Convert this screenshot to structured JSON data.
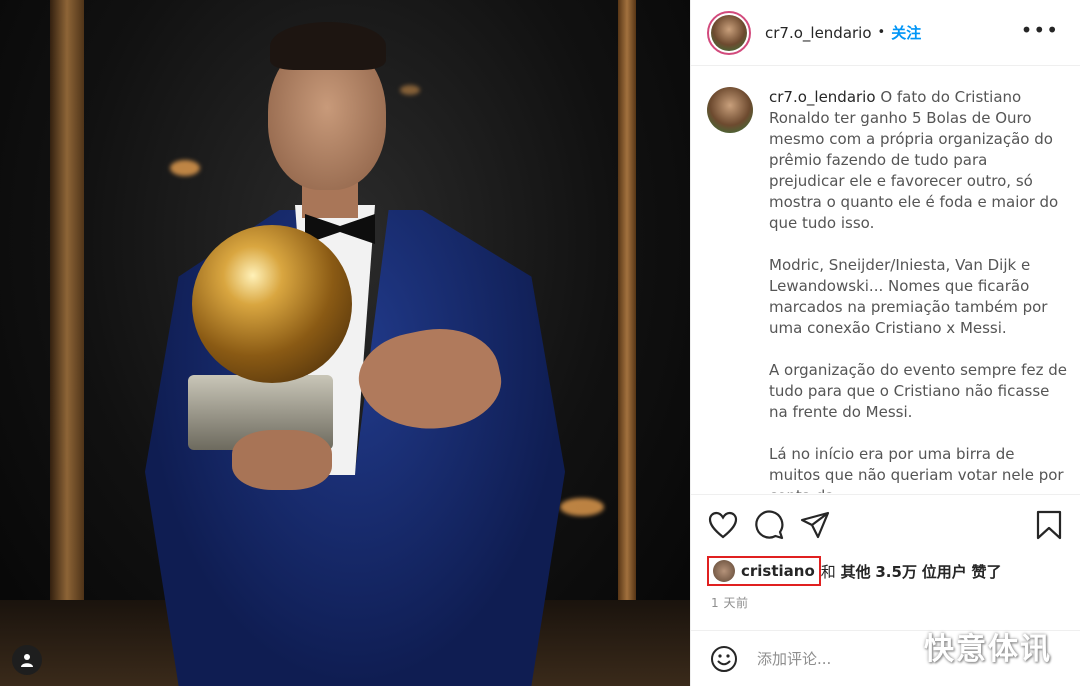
{
  "post": {
    "username": "cr7.o_lendario",
    "separator": "•",
    "follow_label": "关注",
    "more_label": "•••"
  },
  "caption": {
    "username": "cr7.o_lendario",
    "paragraphs": [
      "O fato do Cristiano Ronaldo ter ganho 5 Bolas de Ouro mesmo com a própria organização do prêmio fazendo de tudo para prejudicar ele e favorecer outro, só mostra o quanto ele é foda e maior do que tudo isso.",
      "Modric, Sneijder/Iniesta, Van Dijk e Lewandowski... Nomes que ficarão marcados na premiação também por uma conexão Cristiano x Messi.",
      "A organização do evento sempre fez de tudo para que o Cristiano não ficasse na frente do Messi.",
      "Lá no início era por uma birra de muitos que não queriam votar nele por conta da"
    ]
  },
  "actions": {
    "like_icon": "heart-icon",
    "comment_icon": "comment-icon",
    "share_icon": "send-icon",
    "save_icon": "bookmark-icon"
  },
  "likes": {
    "user": "cristiano",
    "connector": "和",
    "others_prefix": "其他",
    "count": "3.5万",
    "suffix_unit": "位用户",
    "suffix": "赞了"
  },
  "time": "1 天前",
  "comment_box": {
    "placeholder": "添加评论..."
  },
  "watermark": "快意体讯",
  "colors": {
    "accent": "#0095f6",
    "highlight_box": "#e02020",
    "story_ring": "#d24a7c"
  }
}
